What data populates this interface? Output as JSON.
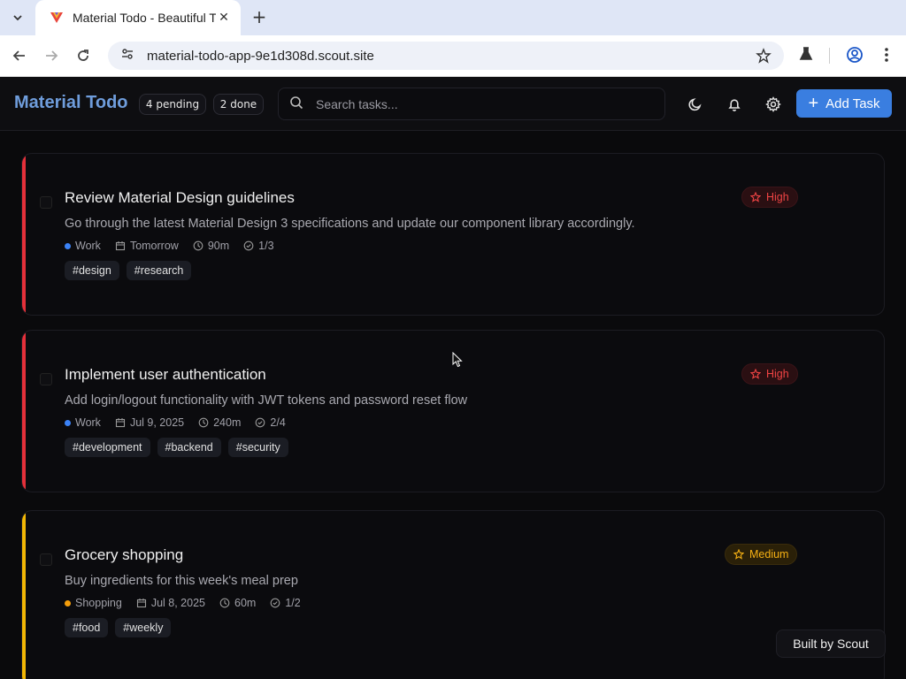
{
  "browser": {
    "tab_title": "Material Todo - Beautiful T",
    "url": "material-todo-app-9e1d308d.scout.site"
  },
  "header": {
    "brand": "Material Todo",
    "pending": "4 pending",
    "done": "2 done",
    "search_placeholder": "Search tasks...",
    "add_label": "Add Task"
  },
  "tasks": [
    {
      "title": "Review Material Design guidelines",
      "description": "Go through the latest Material Design 3 specifications and update our component library accordingly.",
      "category": "Work",
      "category_color": "#3b82f6",
      "due": "Tomorrow",
      "duration": "90m",
      "subtasks": "1/3",
      "tags": [
        "#design",
        "#research"
      ],
      "priority": "High",
      "priority_color": "#ef4444",
      "bar_color": "#e5303a"
    },
    {
      "title": "Implement user authentication",
      "description": "Add login/logout functionality with JWT tokens and password reset flow",
      "category": "Work",
      "category_color": "#3b82f6",
      "due": "Jul 9, 2025",
      "duration": "240m",
      "subtasks": "2/4",
      "tags": [
        "#development",
        "#backend",
        "#security"
      ],
      "priority": "High",
      "priority_color": "#ef4444",
      "bar_color": "#e5303a"
    },
    {
      "title": "Grocery shopping",
      "description": "Buy ingredients for this week's meal prep",
      "category": "Shopping",
      "category_color": "#f59e0b",
      "due": "Jul 8, 2025",
      "duration": "60m",
      "subtasks": "1/2",
      "tags": [
        "#food",
        "#weekly"
      ],
      "priority": "Medium",
      "priority_color": "#f5b014",
      "bar_color": "#f2b705"
    }
  ],
  "badge": {
    "label": "Built by Scout"
  }
}
